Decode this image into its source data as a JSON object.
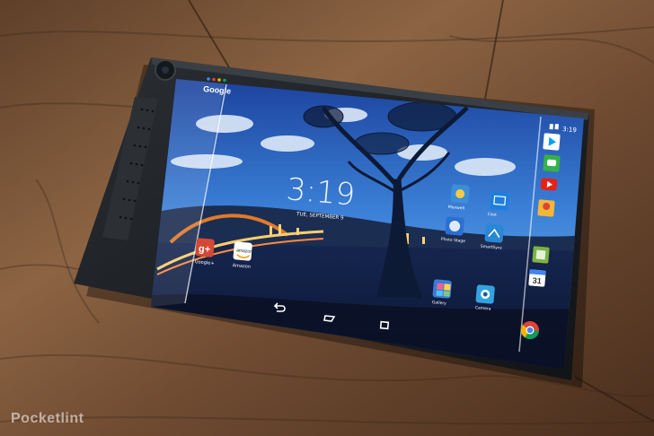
{
  "photo": {
    "watermark": "Pocketlint",
    "device": {
      "status_time": "3:19",
      "clock": "3:19",
      "date": "TUE, SEPTEMBER 9",
      "google_label": "Google",
      "apps_left": [
        {
          "label": "Google+",
          "icon": "google-plus-icon",
          "color": "#d34836"
        },
        {
          "label": "Amazon",
          "icon": "amazon-icon",
          "color": "#ffffff"
        }
      ],
      "apps_center": [
        {
          "label": "Maxwell",
          "icon": "dell-app-icon",
          "color": "#3b8fd6"
        },
        {
          "label": "Photo Stage",
          "icon": "photo-stage-icon",
          "color": "#2a6fd1"
        },
        {
          "label": "Cast",
          "icon": "cast-app-icon",
          "color": "#1d7fe0"
        },
        {
          "label": "SmartSync",
          "icon": "smartsync-icon",
          "color": "#2a87d6"
        },
        {
          "label": "Gallery",
          "icon": "gallery-icon",
          "color": "#3a7bd5"
        },
        {
          "label": "Camera",
          "icon": "camera-icon",
          "color": "#33a3e0"
        }
      ],
      "dock_right": [
        {
          "icon": "play-store-icon",
          "color": "#ffffff"
        },
        {
          "icon": "play-games-icon",
          "color": "#36b04a"
        },
        {
          "icon": "youtube-icon",
          "color": "#e62117"
        },
        {
          "icon": "maps-icon",
          "color": "#f2b63a"
        },
        {
          "icon": "play-newsstand-icon",
          "color": "#7cb342"
        },
        {
          "icon": "calendar-icon",
          "color": "#ffffff"
        },
        {
          "icon": "chrome-icon",
          "color": "#db4437"
        }
      ],
      "nav": [
        {
          "icon": "back-icon"
        },
        {
          "icon": "home-icon"
        },
        {
          "icon": "recents-icon"
        }
      ]
    },
    "colors": {
      "wood_dark": "#4a2f1d",
      "wood_light": "#8c6443",
      "bezel": "#1c1f22",
      "screen_sky": "#2f6fc8"
    }
  }
}
